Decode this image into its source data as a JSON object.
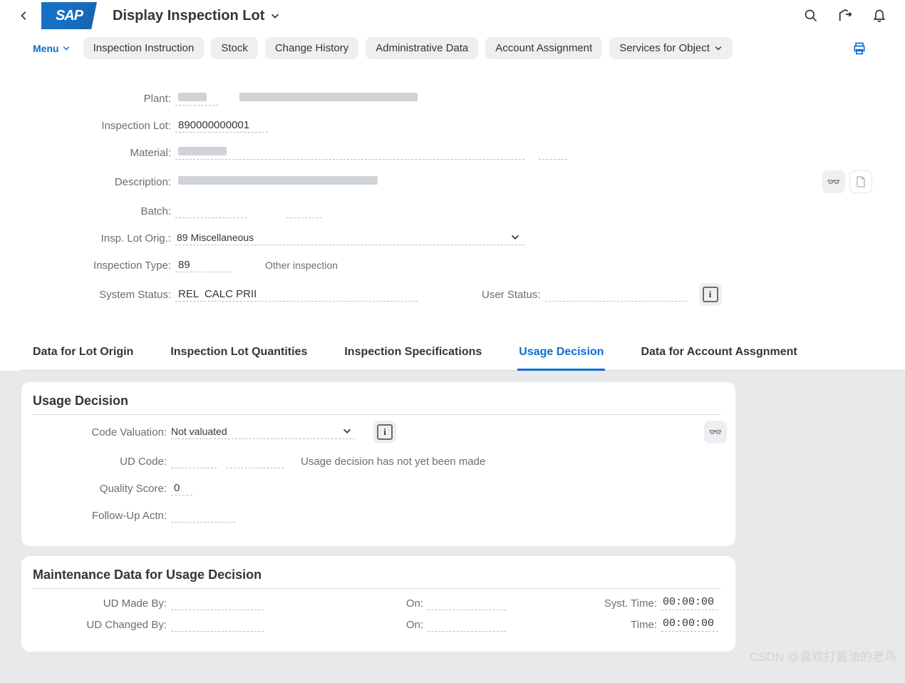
{
  "header": {
    "logo_text": "SAP",
    "title": "Display Inspection Lot"
  },
  "toolbar": {
    "menu_label": "Menu",
    "buttons": [
      "Inspection Instruction",
      "Stock",
      "Change History",
      "Administrative Data",
      "Account Assignment",
      "Services for Object"
    ]
  },
  "form": {
    "plant_label": "Plant",
    "plant_value": "",
    "plant_desc": "",
    "inspection_lot_label": "Inspection Lot",
    "inspection_lot_value": "890000000001",
    "material_label": "Material",
    "material_value": "",
    "description_label": "Description",
    "description_value": "",
    "batch_label": "Batch",
    "batch_value": "",
    "lot_origin_label": "Insp. Lot Orig.",
    "lot_origin_value": "89 Miscellaneous",
    "inspection_type_label": "Inspection Type",
    "inspection_type_value": "89",
    "inspection_type_desc": "Other inspection",
    "system_status_label": "System Status",
    "system_status_value": "REL  CALC PRII",
    "user_status_label": "User Status",
    "user_status_value": ""
  },
  "tabs": [
    "Data for Lot Origin",
    "Inspection Lot Quantities",
    "Inspection Specifications",
    "Usage Decision",
    "Data for Account Assgnment"
  ],
  "active_tab": "Usage Decision",
  "usage_decision": {
    "section_title": "Usage Decision",
    "code_valuation_label": "Code Valuation",
    "code_valuation_value": "Not valuated",
    "ud_code_label": "UD Code",
    "ud_code_value": "",
    "ud_message": "Usage decision has not yet been made",
    "quality_score_label": "Quality Score",
    "quality_score_value": "0",
    "follow_up_label": "Follow-Up Actn",
    "follow_up_value": ""
  },
  "maintenance": {
    "section_title": "Maintenance Data for Usage Decision",
    "made_by_label": "UD Made By",
    "made_by_value": "",
    "made_on_label": "On",
    "made_on_value": "",
    "syst_time_label": "Syst. Time",
    "syst_time_value": "00:00:00",
    "changed_by_label": "UD Changed By",
    "changed_by_value": "",
    "changed_on_label": "On",
    "changed_on_value": "",
    "time_label": "Time",
    "time_value": "00:00:00"
  },
  "watermark": "CSDN @喜欢打酱油的老鸟"
}
